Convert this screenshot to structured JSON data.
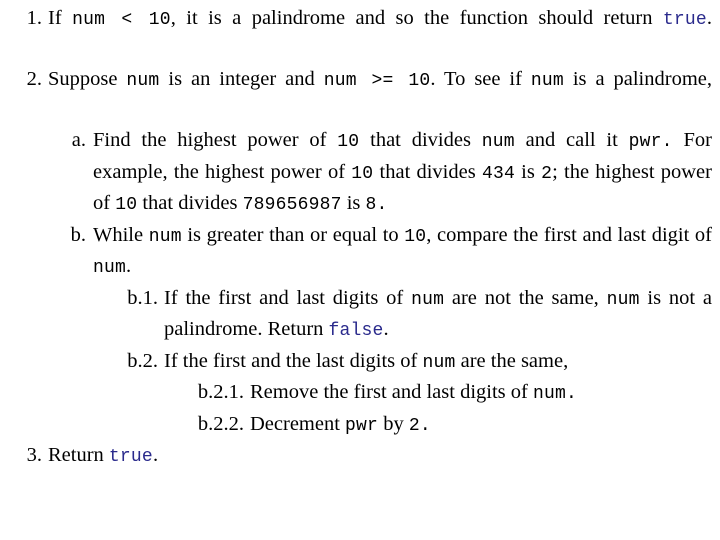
{
  "colors": {
    "background": "#ffffff",
    "text": "#000000",
    "code": "#000000",
    "keyword_literal": "#2a2a8c"
  },
  "document": {
    "type": "algorithm-outline",
    "items": [
      {
        "id": "step-1",
        "marker": "1.",
        "level": 1,
        "segments": [
          {
            "kind": "text",
            "value": "If "
          },
          {
            "kind": "code",
            "value": "num < 10"
          },
          {
            "kind": "text",
            "value": ", it is a palindrome and so the function should return "
          },
          {
            "kind": "literal",
            "value": "true"
          },
          {
            "kind": "text",
            "value": "."
          }
        ],
        "plain": "If num < 10, it is a palindrome and so the function should return true."
      },
      {
        "id": "step-2",
        "marker": "2.",
        "level": 1,
        "segments": [
          {
            "kind": "text",
            "value": "Suppose "
          },
          {
            "kind": "code",
            "value": "num"
          },
          {
            "kind": "text",
            "value": " is an integer and "
          },
          {
            "kind": "code",
            "value": "num >= 10"
          },
          {
            "kind": "text",
            "value": ". To see if "
          },
          {
            "kind": "code",
            "value": "num"
          },
          {
            "kind": "text",
            "value": " is a palindrome,"
          }
        ],
        "plain": "Suppose num is an integer and num >= 10. To see if num is a palindrome,"
      },
      {
        "id": "step-2a",
        "marker": "a.",
        "level": 2,
        "segments": [
          {
            "kind": "text",
            "value": "Find the highest power of "
          },
          {
            "kind": "code",
            "value": "10"
          },
          {
            "kind": "text",
            "value": " that divides "
          },
          {
            "kind": "code",
            "value": "num"
          },
          {
            "kind": "text",
            "value": " and call it "
          },
          {
            "kind": "code",
            "value": "pwr."
          },
          {
            "kind": "text",
            "value": " For example, the highest power of "
          },
          {
            "kind": "code",
            "value": "10"
          },
          {
            "kind": "text",
            "value": " that divides "
          },
          {
            "kind": "code",
            "value": "434"
          },
          {
            "kind": "text",
            "value": " is "
          },
          {
            "kind": "code",
            "value": "2"
          },
          {
            "kind": "text",
            "value": "; the highest power of "
          },
          {
            "kind": "code",
            "value": "10"
          },
          {
            "kind": "text",
            "value": " that divides "
          },
          {
            "kind": "code",
            "value": "789656987"
          },
          {
            "kind": "text",
            "value": " is "
          },
          {
            "kind": "code",
            "value": "8."
          }
        ],
        "plain": "Find the highest power of 10 that divides num and call it pwr. For example, the highest power of 10 that divides 434 is 2; the highest power of 10 that divides 789656987 is 8."
      },
      {
        "id": "step-2b",
        "marker": "b.",
        "level": 2,
        "segments": [
          {
            "kind": "text",
            "value": "While "
          },
          {
            "kind": "code",
            "value": "num"
          },
          {
            "kind": "text",
            "value": " is greater than or equal to "
          },
          {
            "kind": "code",
            "value": "10"
          },
          {
            "kind": "text",
            "value": ", compare the first and last digit of "
          },
          {
            "kind": "code",
            "value": "num"
          },
          {
            "kind": "text",
            "value": "."
          }
        ],
        "plain": "While num is greater than or equal to 10, compare the first and last digit of num."
      },
      {
        "id": "step-2b1",
        "marker": "b.1.",
        "level": 3,
        "segments": [
          {
            "kind": "text",
            "value": "If the first and last digits of "
          },
          {
            "kind": "code",
            "value": "num"
          },
          {
            "kind": "text",
            "value": " are not the same, "
          },
          {
            "kind": "code",
            "value": "num"
          },
          {
            "kind": "text",
            "value": " is not a palindrome. Return "
          },
          {
            "kind": "literal",
            "value": "false"
          },
          {
            "kind": "text",
            "value": "."
          }
        ],
        "plain": "If the first and last digits of num are not the same, num is not a palindrome. Return false."
      },
      {
        "id": "step-2b2",
        "marker": "b.2.",
        "level": 3,
        "segments": [
          {
            "kind": "text",
            "value": "If the first and the last digits of "
          },
          {
            "kind": "code",
            "value": "num"
          },
          {
            "kind": "text",
            "value": " are the same,"
          }
        ],
        "plain": "If the first and the last digits of num are the same,"
      },
      {
        "id": "step-2b21",
        "marker": "b.2.1.",
        "level": 4,
        "segments": [
          {
            "kind": "text",
            "value": "Remove the first and last digits of "
          },
          {
            "kind": "code",
            "value": "num."
          }
        ],
        "plain": "Remove the first and last digits of num."
      },
      {
        "id": "step-2b22",
        "marker": "b.2.2.",
        "level": 4,
        "segments": [
          {
            "kind": "text",
            "value": "Decrement "
          },
          {
            "kind": "code",
            "value": "pwr"
          },
          {
            "kind": "text",
            "value": " by "
          },
          {
            "kind": "code",
            "value": "2."
          }
        ],
        "plain": "Decrement pwr by 2."
      },
      {
        "id": "step-3",
        "marker": "3.",
        "level": 1,
        "segments": [
          {
            "kind": "text",
            "value": "Return "
          },
          {
            "kind": "literal",
            "value": "true"
          },
          {
            "kind": "text",
            "value": "."
          }
        ],
        "plain": "Return true."
      }
    ]
  }
}
